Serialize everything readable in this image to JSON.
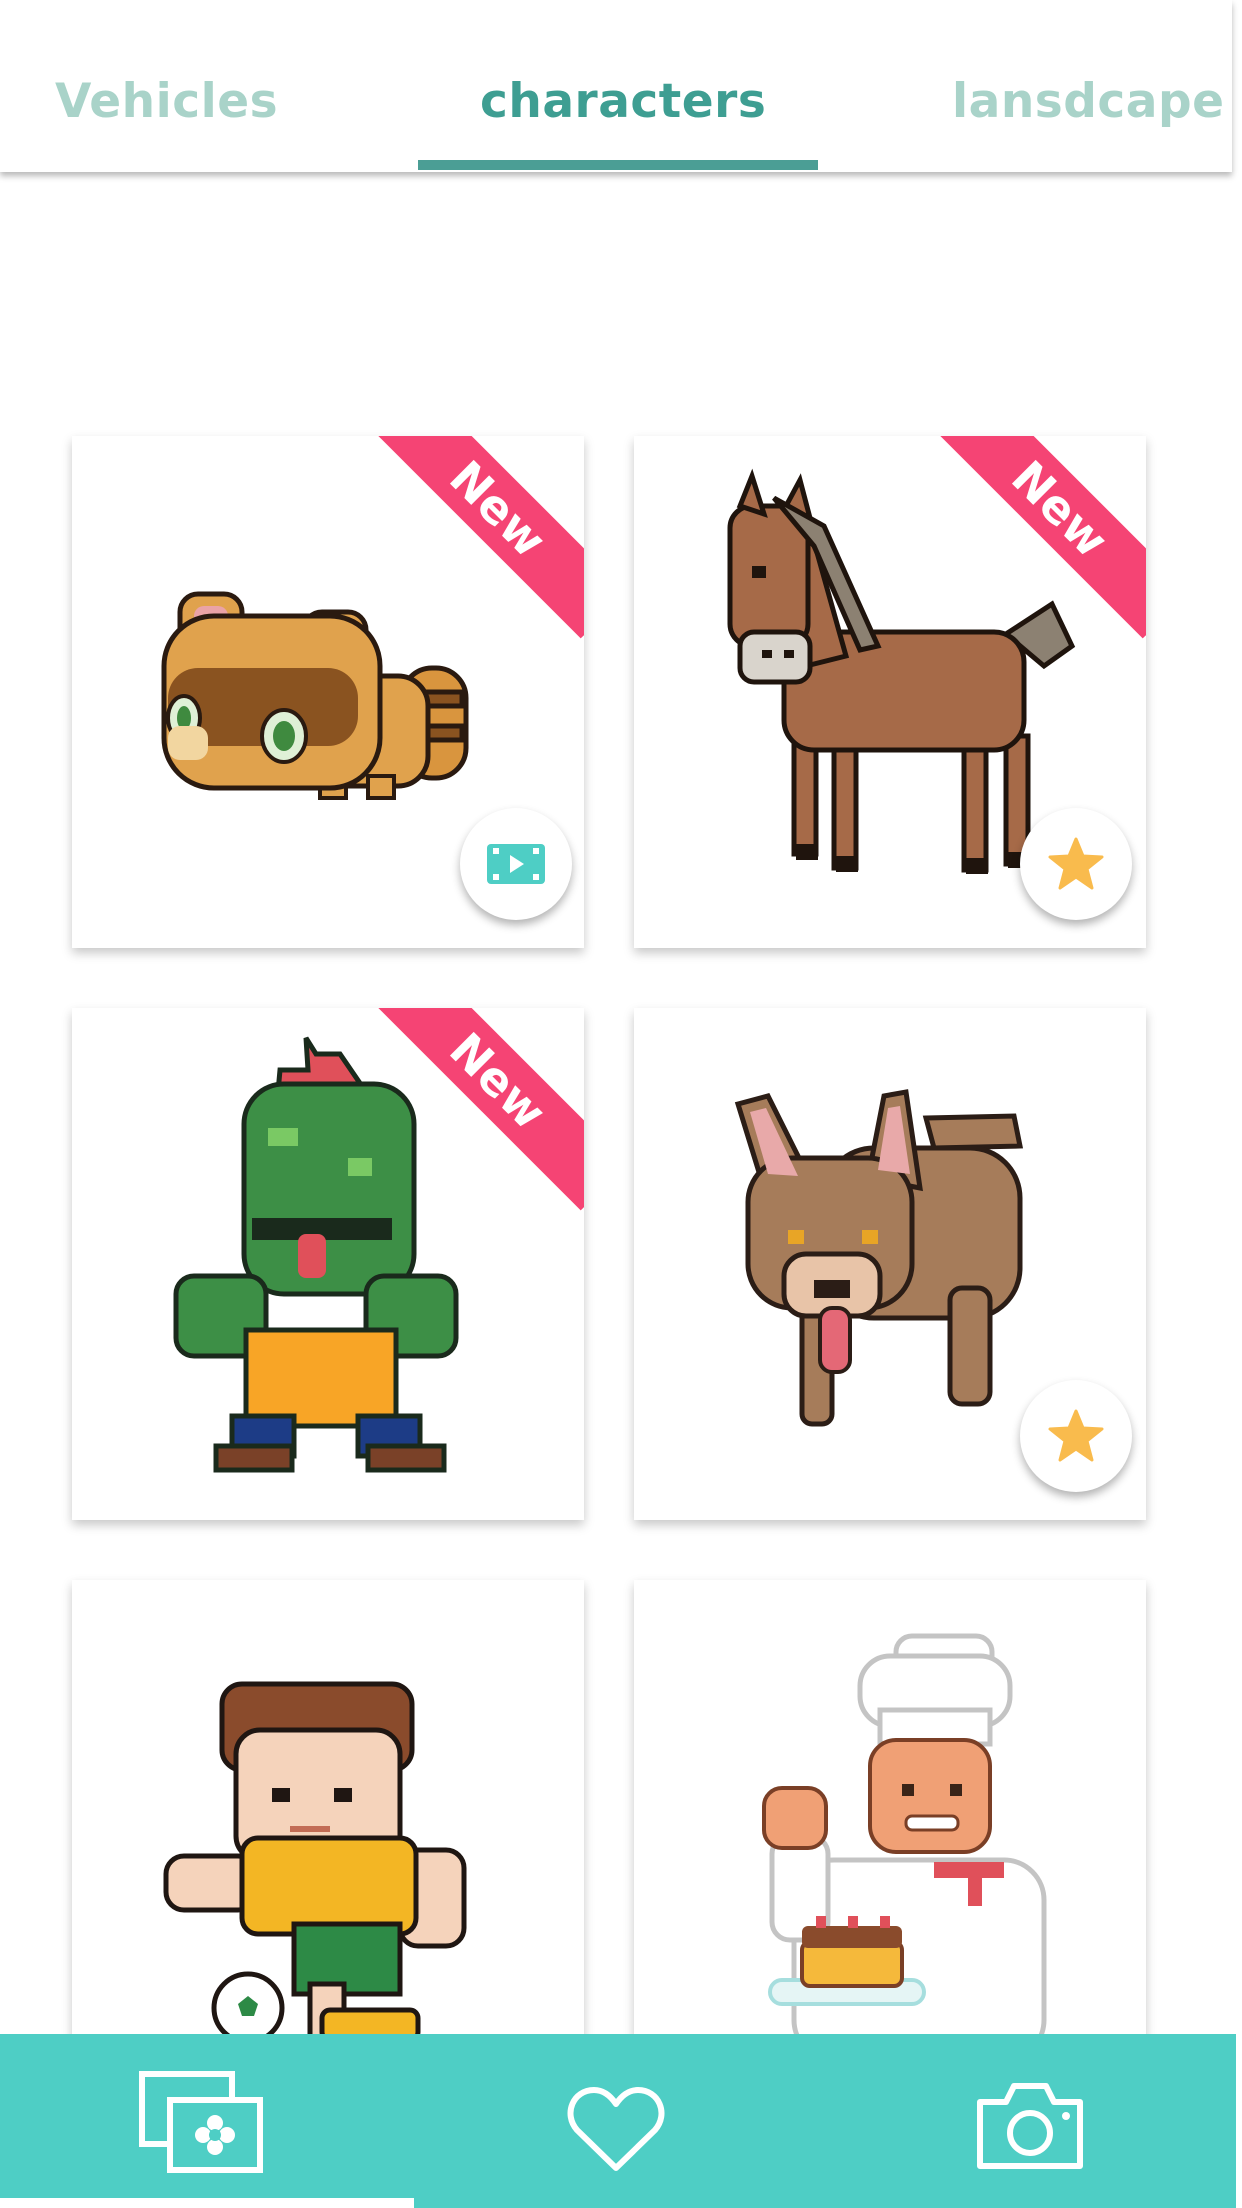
{
  "tabs": [
    {
      "label": "Vehicles",
      "active": false
    },
    {
      "label": "characters",
      "active": true
    },
    {
      "label": "lansdcape",
      "active": false
    }
  ],
  "gallery": {
    "badge_label": "New",
    "items": [
      {
        "subject": "raccoon",
        "new": true,
        "action": "video-icon"
      },
      {
        "subject": "horse",
        "new": true,
        "action": "star-icon"
      },
      {
        "subject": "green-monster",
        "new": true,
        "action": null
      },
      {
        "subject": "dog",
        "new": false,
        "action": "star-icon"
      },
      {
        "subject": "soccer-boy",
        "new": false,
        "action": null
      },
      {
        "subject": "chef",
        "new": false,
        "action": null
      }
    ]
  },
  "bottom_nav": {
    "items": [
      {
        "icon": "gallery-icon",
        "selected": true
      },
      {
        "icon": "heart-icon",
        "selected": false
      },
      {
        "icon": "camera-icon",
        "selected": false
      }
    ]
  },
  "colors": {
    "accent": "#4ecec5",
    "tab_active": "#3e9e92",
    "tab_inactive": "#a9d3c9",
    "badge": "#f54474",
    "star": "#f9bb4d"
  }
}
